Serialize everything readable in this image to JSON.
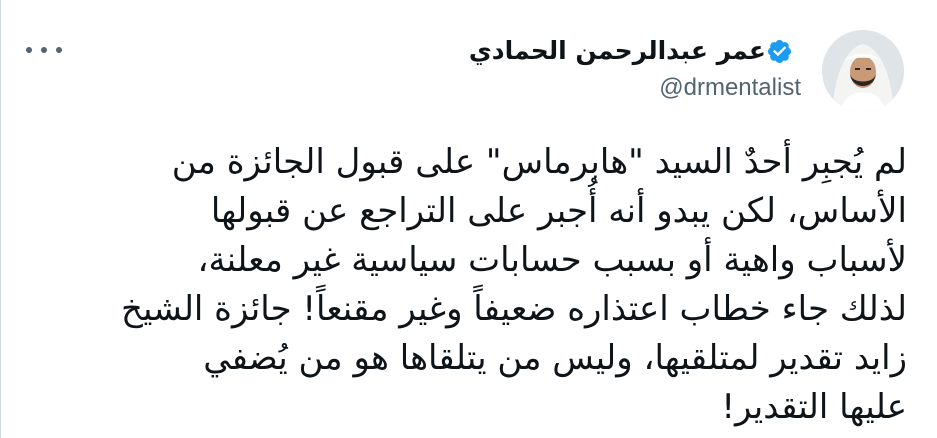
{
  "author": {
    "display_name": "عمر عبدالرحمن الحمادي",
    "handle": "@drmentalist",
    "verified": true,
    "avatar_icon": "profile-photo"
  },
  "menu": {
    "icon": "more-horizontal-icon"
  },
  "tweet": {
    "lines": [
      "لم يُجبِر أحدٌ السيد \"هابرماس\" على قبول الجائزة من",
      "الأساس، لكن يبدو أنه أُجبر على التراجع عن قبولها",
      "لأسباب واهية أو بسبب حسابات سياسية غير معلنة،",
      "لذلك جاء خطاب اعتذاره ضعيفاً وغير مقنعاً! جائزة الشيخ",
      "زايد تقدير لمتلقيها، وليس من يتلقاها هو من يُضفي",
      "عليها التقدير!"
    ]
  },
  "colors": {
    "text": "#0f1419",
    "secondary": "#536471",
    "verified_blue": "#1d9bf0",
    "border": "#cfd9de"
  }
}
